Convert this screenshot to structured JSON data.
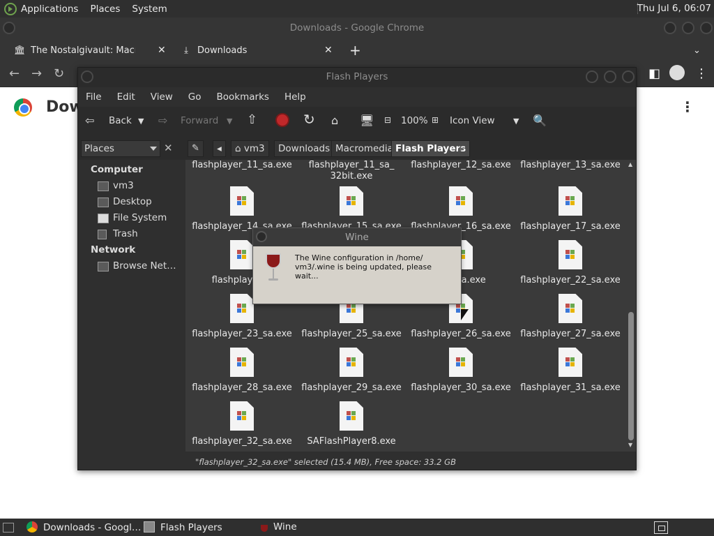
{
  "top_panel": {
    "menus": [
      "Applications",
      "Places",
      "System"
    ],
    "clock": "Thu Jul  6, 06:07"
  },
  "chrome": {
    "window_title": "Downloads - Google Chrome",
    "tabs": [
      {
        "label": "The Nostalgivault: Macromedia",
        "icon": "museum-icon"
      },
      {
        "label": "Downloads",
        "icon": "download-icon"
      }
    ],
    "page_heading": "Dow"
  },
  "file_manager": {
    "window_title": "Flash Players",
    "menubar": [
      "File",
      "Edit",
      "View",
      "Go",
      "Bookmarks",
      "Help"
    ],
    "toolbar": {
      "back": "Back",
      "forward": "Forward",
      "zoom": "100%",
      "view_mode": "Icon View"
    },
    "places_label": "Places",
    "breadcrumbs": [
      "vm3",
      "Downloads",
      "Macromedia",
      "Flash Players"
    ],
    "sidebar": {
      "computer_header": "Computer",
      "computer_items": [
        "vm3",
        "Desktop",
        "File System",
        "Trash"
      ],
      "network_header": "Network",
      "network_items": [
        "Browse Net…"
      ]
    },
    "files_top_partial": [
      "flashplayer_11_sa.exe",
      "flashplayer_11_sa_\n32bit.exe",
      "flashplayer_12_sa.exe",
      "flashplayer_13_sa.exe"
    ],
    "files": [
      "flashplayer_14_sa.exe",
      "flashplayer_15_sa.exe",
      "flashplayer_16_sa.exe",
      "flashplayer_17_sa.exe",
      "flashplayer_1",
      "",
      "_21_sa.exe",
      "flashplayer_22_sa.exe",
      "flashplayer_23_sa.exe",
      "flashplayer_25_sa.exe",
      "flashplayer_26_sa.exe",
      "flashplayer_27_sa.exe",
      "flashplayer_28_sa.exe",
      "flashplayer_29_sa.exe",
      "flashplayer_30_sa.exe",
      "flashplayer_31_sa.exe",
      "flashplayer_32_sa.exe",
      "SAFlashPlayer8.exe"
    ],
    "status": "\"flashplayer_32_sa.exe\" selected (15.4 MB), Free space: 33.2 GB"
  },
  "wine_dialog": {
    "title": "Wine",
    "message_line1": "The Wine configuration in /home/",
    "message_line2": "vm3/.wine is being updated, please wait..."
  },
  "taskbar": {
    "items": [
      "Downloads - Googl…",
      "Flash Players",
      "Wine"
    ]
  }
}
